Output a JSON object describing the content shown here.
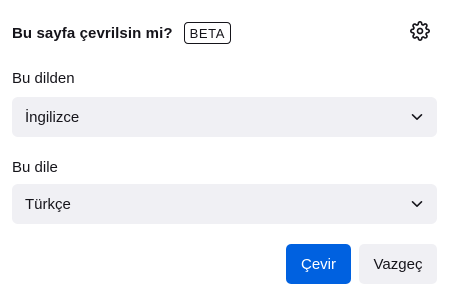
{
  "header": {
    "title": "Bu sayfa çevrilsin mi?",
    "badge": "BETA",
    "settings_icon": "gear-icon"
  },
  "from": {
    "label": "Bu dilden",
    "selected": "İngilizce",
    "icon": "chevron-down-icon"
  },
  "to": {
    "label": "Bu dile",
    "selected": "Türkçe",
    "icon": "chevron-down-icon"
  },
  "actions": {
    "translate_label": "Çevir",
    "cancel_label": "Vazgeç"
  },
  "colors": {
    "primary": "#0061e0",
    "secondary_bg": "#f0f0f4",
    "text": "#15141a"
  }
}
